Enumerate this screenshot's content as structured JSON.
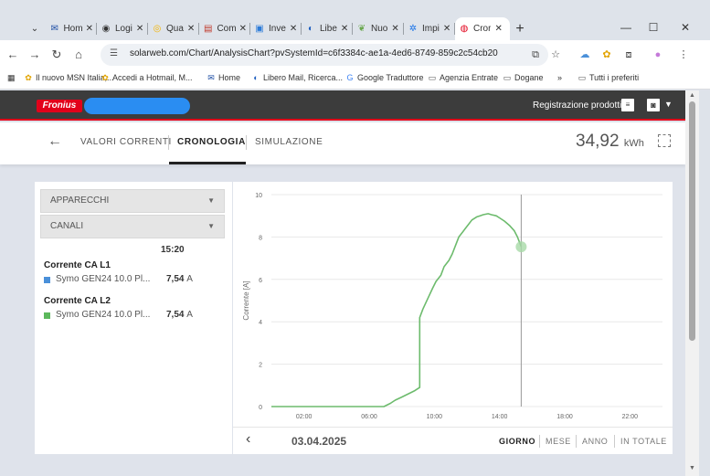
{
  "browser": {
    "tabs": [
      {
        "label": "Hom",
        "icon": "mail-icon",
        "color": "#1a4ba3"
      },
      {
        "label": "Logi",
        "icon": "globe-icon",
        "color": "#333333"
      },
      {
        "label": "Qua",
        "icon": "circle-icon",
        "color": "#f4b400"
      },
      {
        "label": "Com",
        "icon": "doc-icon",
        "color": "#c0392b"
      },
      {
        "label": "Inve",
        "icon": "tab-icon",
        "color": "#2b7bd8"
      },
      {
        "label": "Libe",
        "icon": "libero-icon",
        "color": "#1f5fbf"
      },
      {
        "label": "Nuo",
        "icon": "leaf-icon",
        "color": "#6aa84f"
      },
      {
        "label": "Impi",
        "icon": "gear-icon",
        "color": "#1a73e8"
      },
      {
        "label": "Cror",
        "icon": "solar-icon",
        "color": "#e2001a",
        "active": true
      }
    ],
    "new_tab": "+",
    "url": "solarweb.com/Chart/AnalysisChart?pvSystemId=c6f3384c-ae1a-4ed6-8749-859c2c54cb20",
    "bookmarks": [
      {
        "label": "Il nuovo MSN Italia,...",
        "icon": "msn-icon"
      },
      {
        "label": "Accedi a Hotmail, M...",
        "icon": "msn-icon"
      },
      {
        "label": "Home",
        "icon": "mail-icon"
      },
      {
        "label": "Libero Mail, Ricerca...",
        "icon": "libero-icon"
      },
      {
        "label": "Google Traduttore",
        "icon": "google-icon"
      },
      {
        "label": "Agenzia Entrate",
        "icon": "folder-icon"
      },
      {
        "label": "Dogane",
        "icon": "folder-icon"
      },
      {
        "label": "»",
        "icon": ""
      },
      {
        "label": "Tutti i preferiti",
        "icon": "folder-icon"
      }
    ]
  },
  "app": {
    "logo": "Fronius",
    "product_registration": "Registrazione prodotti",
    "tabs": [
      {
        "label": "VALORI CORRENTI"
      },
      {
        "label": "CRONOLOGIA",
        "active": true
      },
      {
        "label": "SIMULAZIONE"
      }
    ],
    "energy_value": "34,92",
    "energy_unit": "kWh"
  },
  "panel": {
    "dropdown_devices": "APPARECCHI",
    "dropdown_channels": "CANALI",
    "time": "15:20",
    "groups": [
      {
        "title": "Corrente CA L1",
        "device": "Symo GEN24 10.0 Pl...",
        "value": "7,54",
        "unit": "A",
        "color": "#4a90d9"
      },
      {
        "title": "Corrente CA L2",
        "device": "Symo GEN24 10.0 Pl...",
        "value": "7,54",
        "unit": "A",
        "color": "#5cb85c"
      }
    ]
  },
  "footer": {
    "date": "03.04.2025",
    "periods": [
      {
        "label": "GIORNO",
        "active": true
      },
      {
        "label": "MESE"
      },
      {
        "label": "ANNO"
      },
      {
        "label": "IN TOTALE"
      }
    ]
  },
  "chart_data": {
    "type": "line",
    "ylabel": "Corrente [A]",
    "xlabel": "",
    "ylim": [
      0,
      10
    ],
    "yticks": [
      0,
      2,
      4,
      6,
      8,
      10
    ],
    "xlim": [
      0,
      24
    ],
    "xticks": [
      "02:00",
      "06:00",
      "10:00",
      "14:00",
      "18:00",
      "22:00"
    ],
    "xtick_values": [
      2,
      6,
      10,
      14,
      18,
      22
    ],
    "grid": true,
    "color": "#6dbb6d",
    "cursor_time": 15.33,
    "series": [
      {
        "values_x": [
          0,
          6.9,
          7.3,
          7.6,
          8.0,
          8.4,
          8.8,
          9.1,
          9.1,
          9.3,
          9.6,
          9.9,
          10.1,
          10.4,
          10.6,
          10.9,
          11.1,
          11.3,
          11.5,
          11.7,
          11.9,
          12.1,
          12.3,
          12.6,
          12.8,
          13.0,
          13.3,
          13.5,
          13.8,
          14.0,
          14.3,
          14.6,
          14.9,
          15.1,
          15.33
        ],
        "values_y": [
          0,
          0,
          0.15,
          0.3,
          0.45,
          0.6,
          0.75,
          0.9,
          4.2,
          4.6,
          5.1,
          5.6,
          5.9,
          6.2,
          6.6,
          6.9,
          7.2,
          7.6,
          8.0,
          8.2,
          8.4,
          8.6,
          8.8,
          8.95,
          9.0,
          9.05,
          9.1,
          9.05,
          9.0,
          8.9,
          8.75,
          8.55,
          8.3,
          8.0,
          7.54
        ]
      }
    ]
  }
}
